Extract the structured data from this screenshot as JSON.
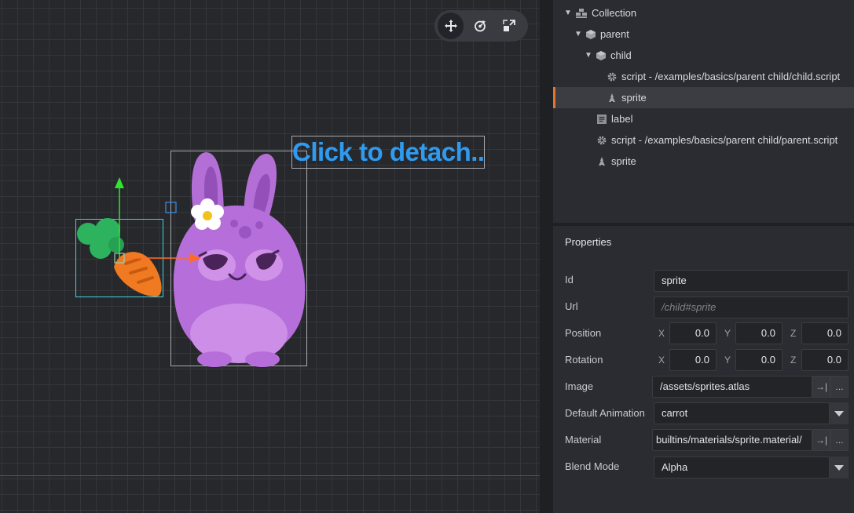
{
  "scene": {
    "overlay_text": "Click to detach..."
  },
  "toolbar": {
    "items": [
      {
        "name": "move-tool",
        "icon": "move-icon",
        "active": true
      },
      {
        "name": "rotate-tool",
        "icon": "rotate-icon",
        "active": false
      },
      {
        "name": "scale-tool",
        "icon": "scale-icon",
        "active": false
      }
    ]
  },
  "outline": {
    "items": [
      {
        "label": "Collection",
        "icon": "collection-icon",
        "expanded": true
      },
      {
        "label": "parent",
        "icon": "game-object-icon",
        "expanded": true
      },
      {
        "label": "child",
        "icon": "game-object-icon",
        "expanded": true
      },
      {
        "label": "script - /examples/basics/parent child/child.script",
        "icon": "script-gear-icon"
      },
      {
        "label": "sprite",
        "icon": "sprite-icon",
        "selected": true
      },
      {
        "label": "label",
        "icon": "label-icon"
      },
      {
        "label": "script - /examples/basics/parent child/parent.script",
        "icon": "script-gear-icon"
      },
      {
        "label": "sprite",
        "icon": "sprite-icon"
      }
    ]
  },
  "properties": {
    "title": "Properties",
    "id_label": "Id",
    "id_value": "sprite",
    "url_label": "Url",
    "url_value": "/child#sprite",
    "position_label": "Position",
    "position": {
      "x": "0.0",
      "y": "0.0",
      "z": "0.0"
    },
    "rotation_label": "Rotation",
    "rotation": {
      "x": "0.0",
      "y": "0.0",
      "z": "0.0"
    },
    "axis_labels": {
      "x": "X",
      "y": "Y",
      "z": "Z"
    },
    "image_label": "Image",
    "image_value": "/assets/sprites.atlas",
    "default_animation_label": "Default Animation",
    "default_animation_value": "carrot",
    "material_label": "Material",
    "material_value": "/builtins/materials/sprite.material",
    "blend_mode_label": "Blend Mode",
    "blend_mode_value": "Alpha",
    "goto_symbol": "→|",
    "browse_symbol": "..."
  },
  "colors": {
    "accent_orange": "#e0762f",
    "overlay_text_blue": "#2f9bf0",
    "x_axis_red": "#a7343a",
    "gizmo_green": "#2ee62e",
    "gizmo_orange": "#ff6a2a",
    "selection_cyan": "#3fd3e0"
  }
}
